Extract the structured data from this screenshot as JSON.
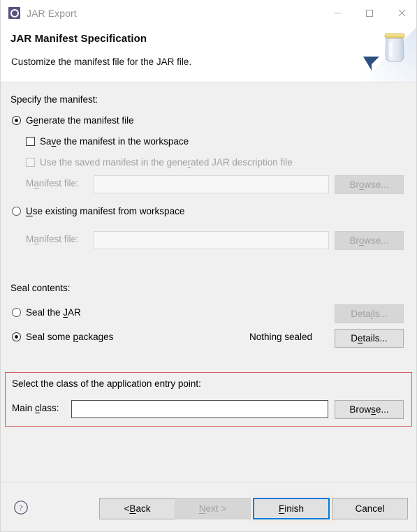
{
  "window": {
    "title": "JAR Export",
    "icon": "jar-export-icon",
    "controls": {
      "minimize": "minimize-icon",
      "maximize": "maximize-icon",
      "close": "close-icon"
    }
  },
  "header": {
    "title": "JAR Manifest Specification",
    "description": "Customize the manifest file for the JAR file.",
    "artwork": "jar-wizard-banner-icon"
  },
  "manifest_section": {
    "label": "Specify the manifest:",
    "generate_radio": {
      "label_pre": "G",
      "label_mnemonic": "e",
      "label_post": "nerate the manifest file",
      "full_label": "Generate the manifest file",
      "checked": true
    },
    "save_checkbox": {
      "label_pre": "Sa",
      "label_mnemonic": "v",
      "label_post": "e the manifest in the workspace",
      "full_label": "Save the manifest in the workspace",
      "checked": false,
      "enabled": true
    },
    "use_saved_checkbox": {
      "label_pre": "Use the saved manifest in the gene",
      "label_mnemonic": "r",
      "label_post": "ated JAR description file",
      "full_label": "Use the saved manifest in the generated JAR description file",
      "checked": false,
      "enabled": false
    },
    "manifest_file_label": {
      "pre": "M",
      "mnemonic": "a",
      "post": "nifest file:",
      "full": "Manifest file:"
    },
    "manifest_file_value": "",
    "manifest_file_browse": {
      "pre": "Br",
      "mnemonic": "o",
      "post": "wse...",
      "full": "Browse...",
      "enabled": false
    },
    "use_existing_radio": {
      "label_pre": "",
      "label_mnemonic": "U",
      "label_post": "se existing manifest from workspace",
      "full_label": "Use existing manifest from workspace",
      "checked": false
    },
    "existing_file_label": {
      "pre": "M",
      "mnemonic": "a",
      "post": "nifest file:",
      "full": "Manifest file:"
    },
    "existing_file_value": "",
    "existing_file_browse": {
      "pre": "Br",
      "mnemonic": "o",
      "post": "wse...",
      "full": "Browse...",
      "enabled": false
    }
  },
  "seal_section": {
    "label": "Seal contents:",
    "seal_jar_radio": {
      "label_pre": "Seal the ",
      "label_mnemonic": "J",
      "label_post": "AR",
      "full_label": "Seal the JAR",
      "checked": false
    },
    "seal_jar_details": {
      "pre": "Deta",
      "mnemonic": "i",
      "post": "ls...",
      "full": "Details...",
      "enabled": false
    },
    "seal_packages_radio": {
      "label_pre": "Seal some ",
      "label_mnemonic": "p",
      "label_post": "ackages",
      "full_label": "Seal some packages",
      "checked": true
    },
    "seal_status": "Nothing sealed",
    "seal_packages_details": {
      "pre": "D",
      "mnemonic": "e",
      "post": "tails...",
      "full": "Details...",
      "enabled": true
    }
  },
  "entry_point_section": {
    "label": "Select the class of the application entry point:",
    "main_class_label": {
      "pre": "Main ",
      "mnemonic": "c",
      "post": "lass:",
      "full": "Main class:"
    },
    "main_class_value": "",
    "main_class_placeholder": "",
    "browse": {
      "pre": "Brow",
      "mnemonic": "s",
      "post": "e...",
      "full": "Browse...",
      "enabled": true
    },
    "highlight_color": "#d25a5a"
  },
  "footer": {
    "help_icon": "help-icon",
    "back": {
      "pre": "< ",
      "mnemonic": "B",
      "post": "ack",
      "full": "< Back",
      "enabled": true
    },
    "next": {
      "pre": "",
      "mnemonic": "N",
      "post": "ext >",
      "full": "Next >",
      "enabled": false
    },
    "finish": {
      "pre": "",
      "mnemonic": "F",
      "post": "inish",
      "full": "Finish",
      "enabled": true,
      "default": true
    },
    "cancel": {
      "pre": "Cancel",
      "mnemonic": "",
      "post": "",
      "full": "Cancel",
      "enabled": true
    },
    "accent_color": "#0078d7"
  }
}
